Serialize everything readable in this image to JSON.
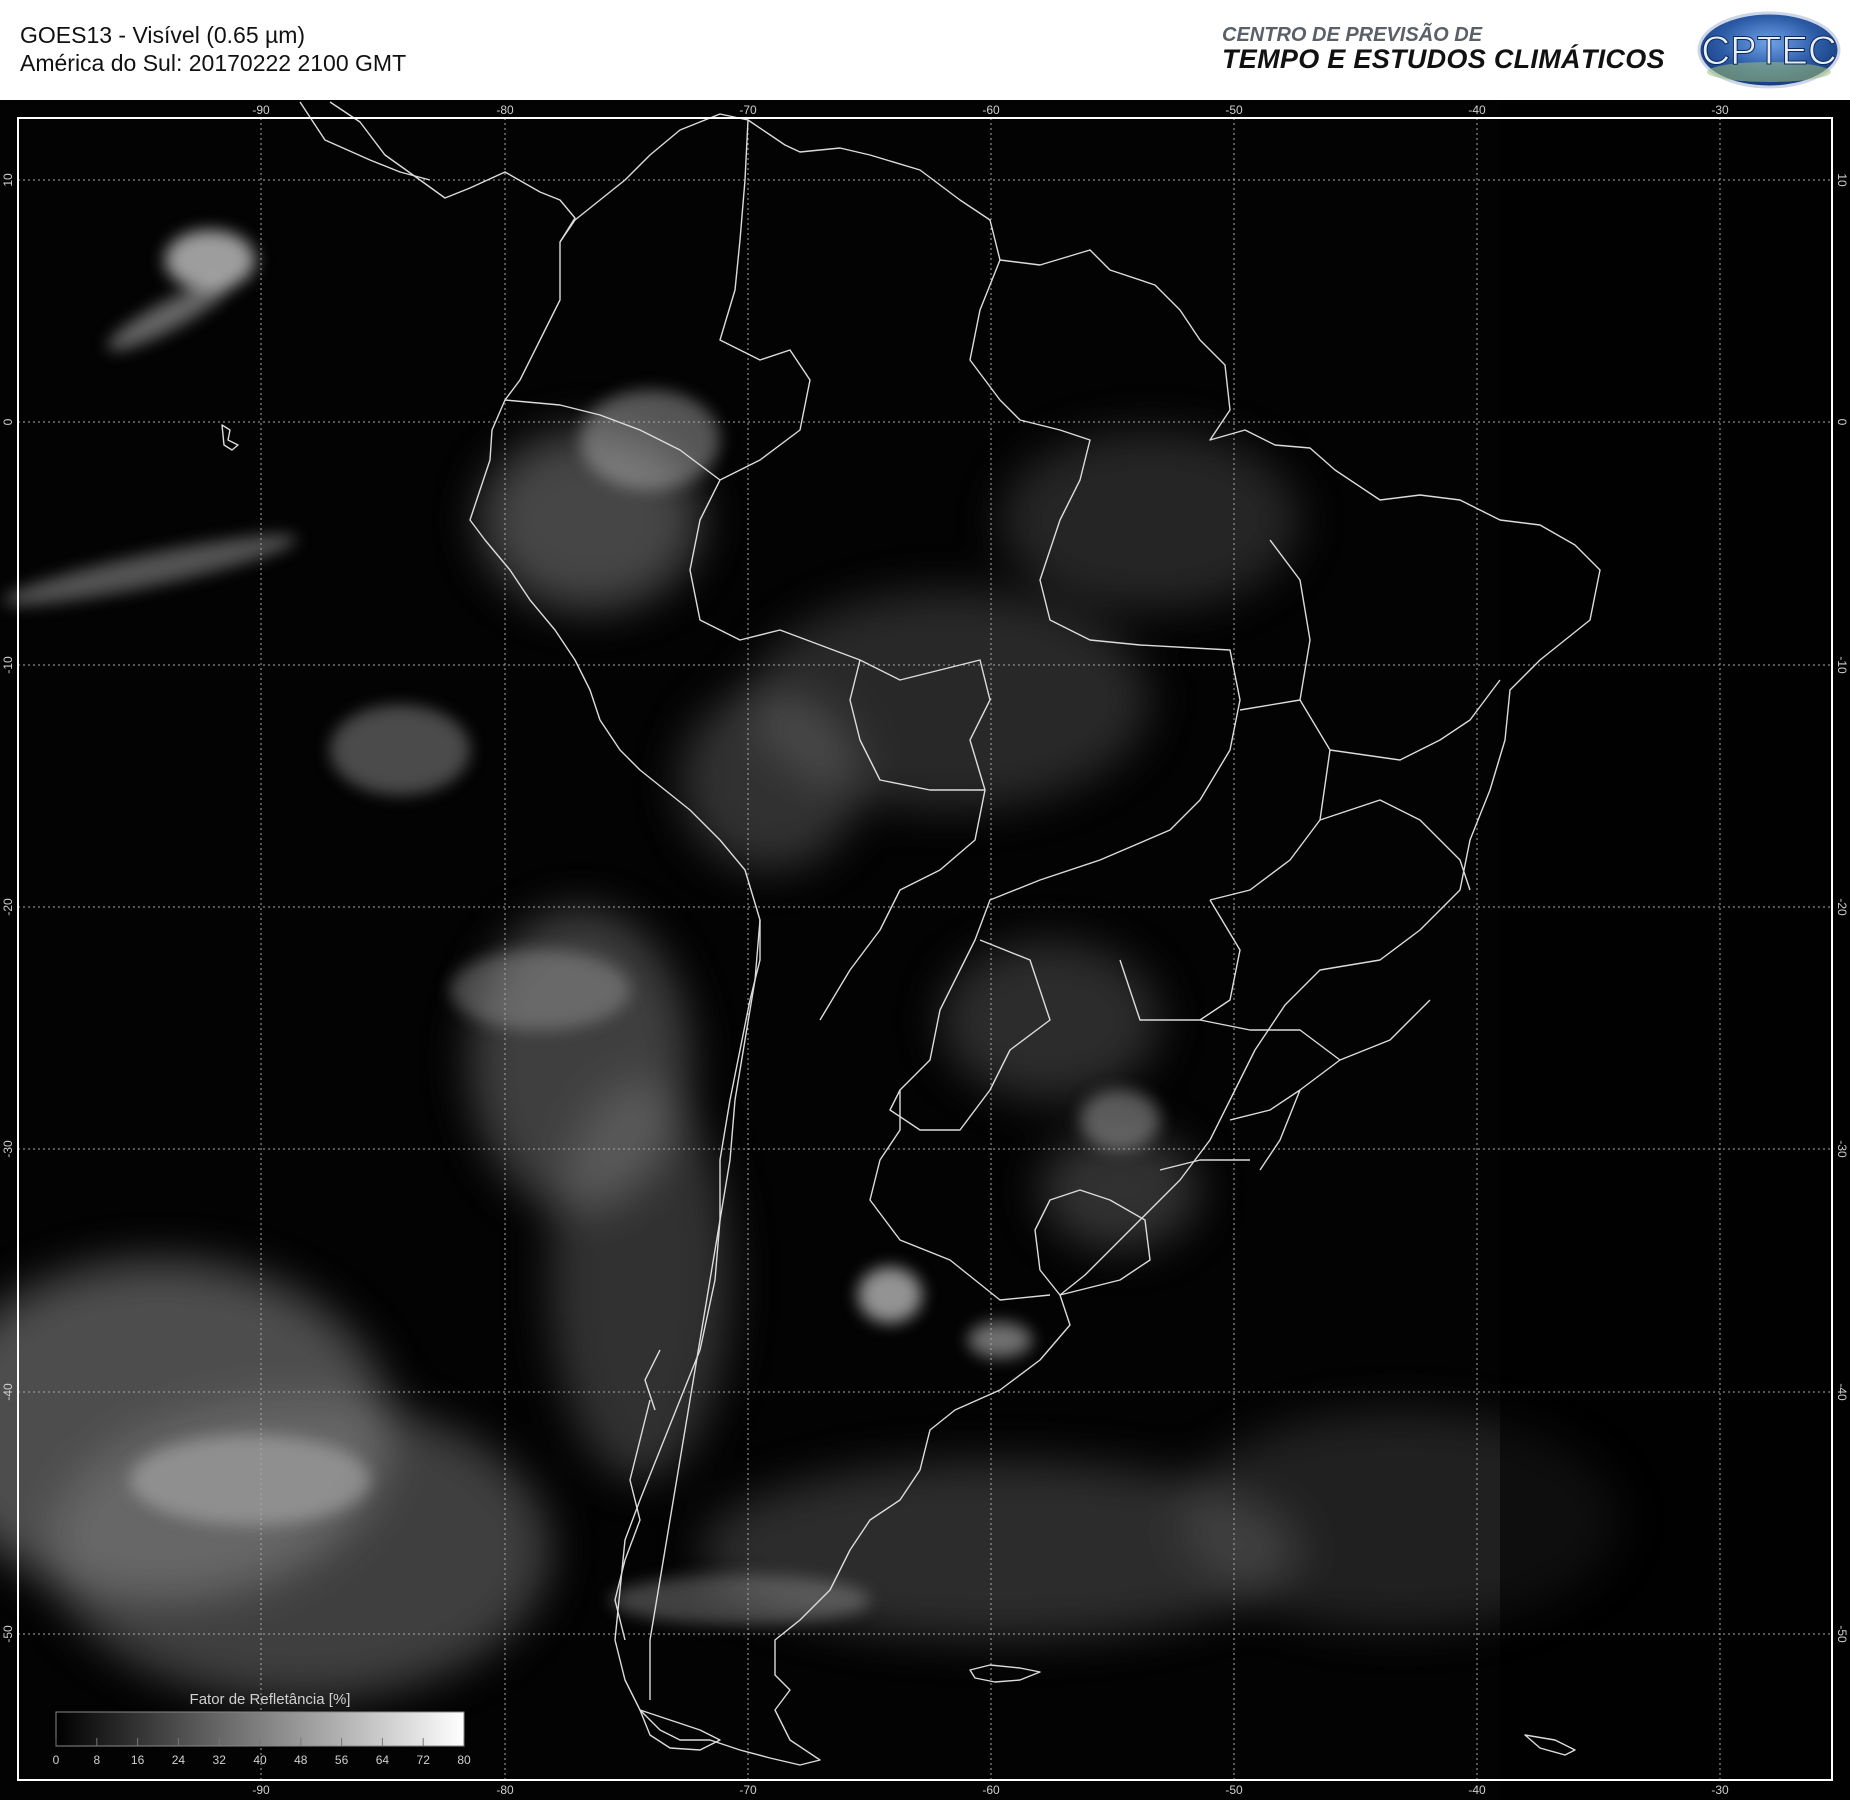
{
  "header": {
    "title_line1": "GOES13 - Visível (0.65 µm)",
    "title_line2": "América do Sul: 20170222 2100 GMT",
    "org_line1": "CENTRO DE PREVISÃO DE",
    "org_line2": "TEMPO E ESTUDOS CLIMÁTICOS",
    "logo_text": "CPTEC"
  },
  "map": {
    "lon_labels": [
      "-90",
      "-80",
      "-70",
      "-60",
      "-50",
      "-40",
      "-30"
    ],
    "lat_labels": [
      "10",
      "0",
      "-10",
      "-20",
      "-30",
      "-40",
      "-50"
    ],
    "lon_range": [
      -100.8,
      -24.6
    ],
    "lat_range": [
      12.6,
      -56.0
    ]
  },
  "colorbar": {
    "title": "Fator de Refletância [%]",
    "ticks": [
      "0",
      "8",
      "16",
      "24",
      "32",
      "40",
      "48",
      "56",
      "64",
      "72",
      "80"
    ]
  },
  "colors": {
    "background": "#000000",
    "coastline": "#d8d8d8",
    "grid": "#bdbdbd",
    "logo_blue": "#2b5aa5"
  }
}
